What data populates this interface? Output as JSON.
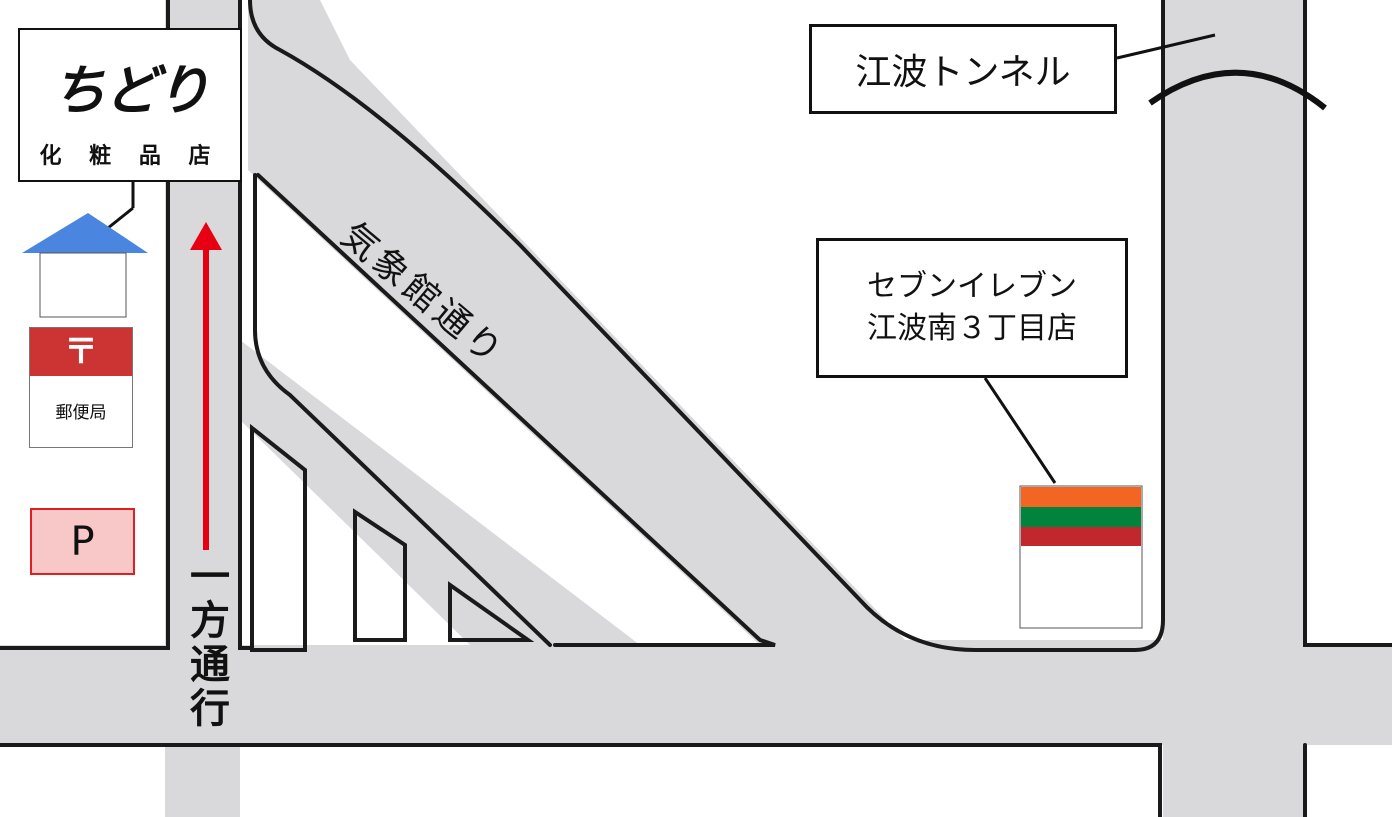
{
  "shop": {
    "logo_text": "ちどり",
    "subtitle": "化 粧 品 店"
  },
  "landmarks": {
    "tunnel": "江波トンネル",
    "seven_line1": "セブンイレブン",
    "seven_line2": "江波南３丁目店",
    "post_symbol": "〒",
    "post_label": "郵便局",
    "parking": "P"
  },
  "streets": {
    "diagonal_name": "気象館通り",
    "one_way_label": [
      "一",
      "方",
      "通",
      "行"
    ]
  },
  "colors": {
    "road": "#d9d9db",
    "road_edge": "#1a1a1a",
    "arrow": "#e60012",
    "house_roof": "#4a86e0",
    "post_red": "#cc3333",
    "seven_orange": "#f26522",
    "seven_green": "#00843d",
    "seven_red": "#c1272d",
    "parking_fill": "#f8c8c8",
    "parking_border": "#e02020"
  },
  "icons": [
    "house-icon",
    "post-office-icon",
    "parking-icon",
    "convenience-store-icon",
    "tunnel-arch-icon",
    "one-way-arrow-icon"
  ]
}
